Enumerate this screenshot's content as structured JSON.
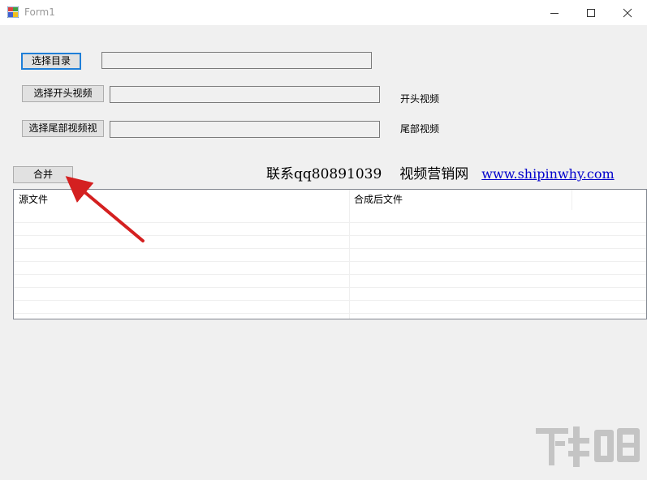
{
  "window": {
    "title": "Form1",
    "icon": "windows-forms-app-icon",
    "controls": [
      "minimize-icon",
      "maximize-icon",
      "close-icon"
    ]
  },
  "buttons": {
    "select_dir": "选择目录",
    "select_intro": "选择开头视频",
    "select_outro": "选择尾部视频视",
    "merge": "合并"
  },
  "fields": {
    "dir_value": "",
    "intro_value": "",
    "outro_value": ""
  },
  "labels": {
    "intro": "开头视频",
    "outro": "尾部视频"
  },
  "contact": {
    "qq": "联系qq80891039",
    "brand": "视频营销网",
    "url": "www.shipinwhy.com"
  },
  "list": {
    "columns": [
      "源文件",
      "合成后文件",
      ""
    ],
    "rows": []
  },
  "colors": {
    "focus_border": "#1f7fd8",
    "link": "#0000cc",
    "annotation_arrow": "#d42020"
  }
}
